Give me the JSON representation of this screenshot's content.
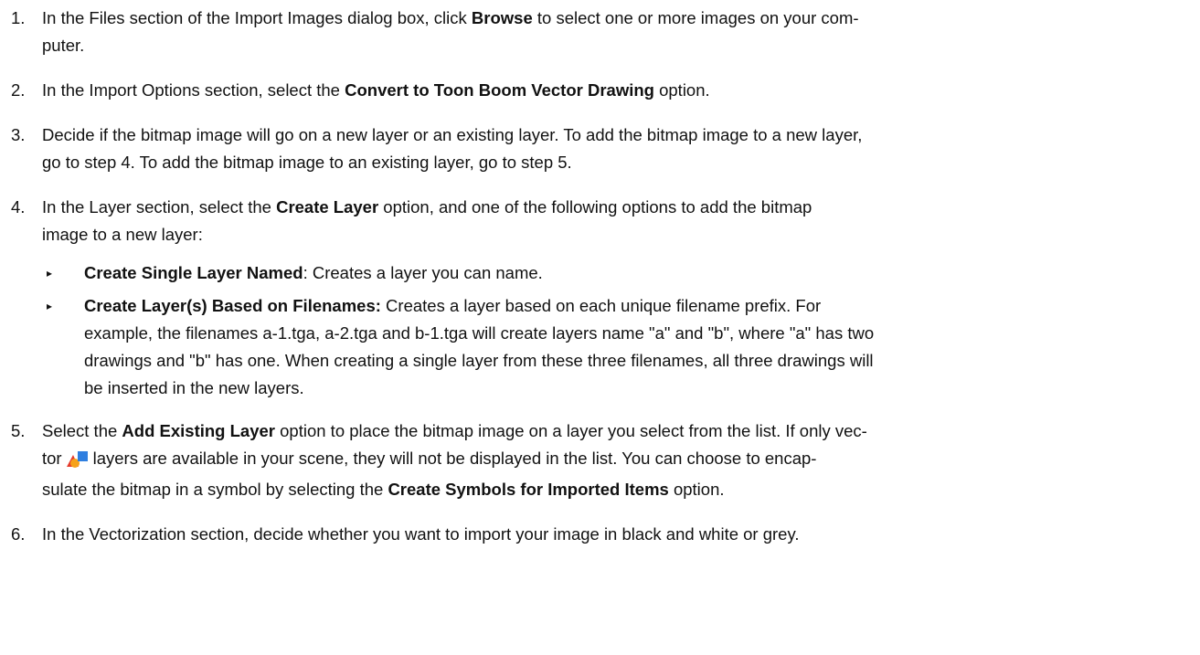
{
  "steps": [
    {
      "num": "1.",
      "pre": "In the Files section of the Import Images dialog box, click ",
      "bold": "Browse",
      "post": " to select one or more images on your com-",
      "post2": "puter."
    },
    {
      "num": "2.",
      "pre": "In the Import Options section, select the ",
      "bold": "Convert to Toon Boom Vector Drawing",
      "post": " option."
    },
    {
      "num": "3.",
      "line1": "Decide if the bitmap image will go on a new layer or an existing layer. To add the bitmap image to a new layer,",
      "line2": "go to step 4. To add the bitmap image to an existing layer, go to step 5."
    },
    {
      "num": "4.",
      "pre": "In the Layer section, select the ",
      "bold": "Create Layer",
      "post": " option, and one of the following options to add the bitmap",
      "post2": "image to a new layer:",
      "bullets": [
        {
          "mark": "▸",
          "bold": "Create Single Layer Named",
          "text": ": Creates a layer you can name."
        },
        {
          "mark": "▸",
          "bold": "Create Layer(s) Based on Filenames:",
          "text": " Creates a layer based on each unique filename prefix. For",
          "line2": "example, the filenames a-1.tga, a-2.tga and b-1.tga will create layers name \"a\" and \"b\", where \"a\" has two",
          "line3": "drawings and \"b\" has one. When creating a single layer from these three filenames, all three drawings will",
          "line4": "be inserted in the new layers."
        }
      ]
    },
    {
      "num": "5.",
      "pre": "Select the ",
      "bold": "Add Existing Layer",
      "post": " option to place the bitmap image on a layer you select from the list. If only vec-",
      "line2a": "tor",
      "line2b": "layers are available in your scene, they will not be displayed in the list. You can choose to encap-",
      "line3a": "sulate the bitmap in a symbol by selecting the ",
      "bold2": "Create Symbols for Imported Items",
      "line3b": " option.",
      "icon": "vector-layer-icon"
    },
    {
      "num": "6.",
      "text": "In the Vectorization section, decide whether you want to import your image in black and white or grey."
    }
  ],
  "colors": {
    "text": "#111111",
    "icon_red": "#e53b2c",
    "icon_orange": "#f6a21a",
    "icon_blue": "#2f7fe0"
  }
}
